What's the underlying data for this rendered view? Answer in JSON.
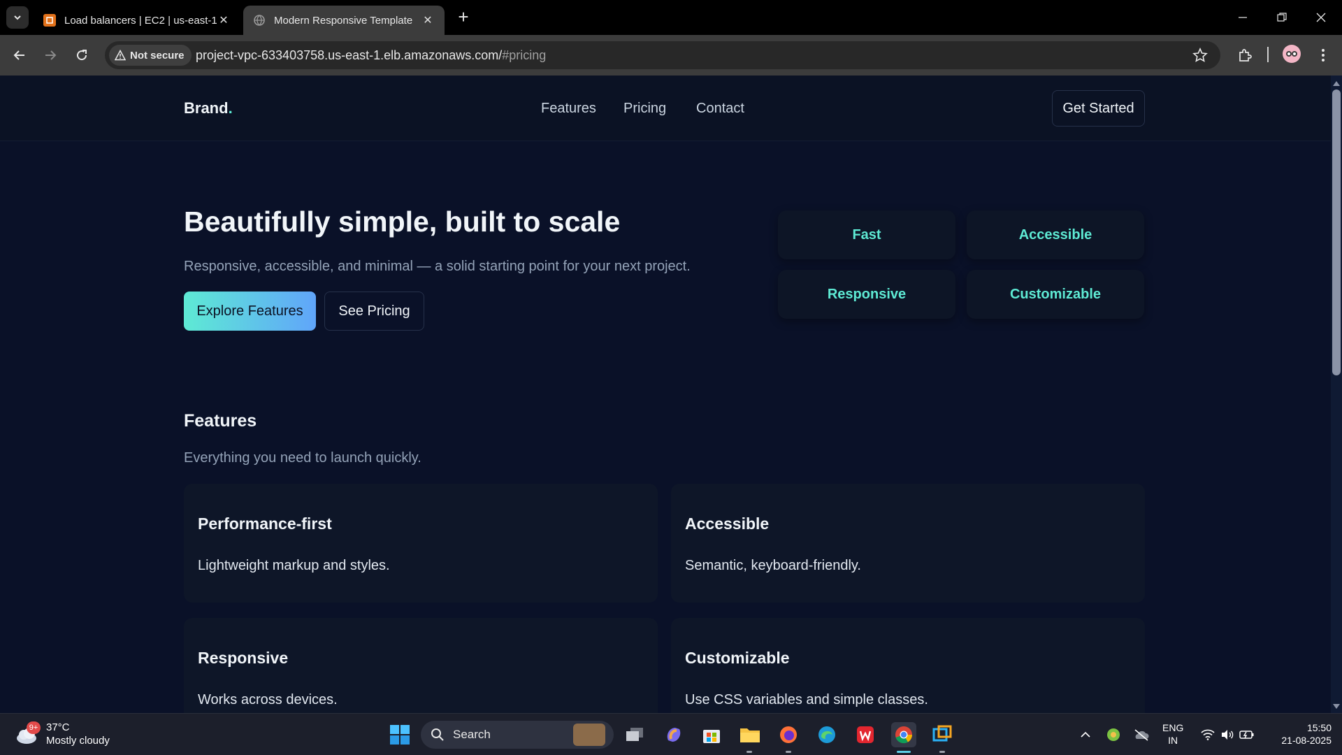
{
  "browser": {
    "tabs": [
      {
        "title": "Load balancers | EC2 | us-east-1",
        "active": false,
        "favicon": "aws-icon"
      },
      {
        "title": "Modern Responsive Template",
        "active": true,
        "favicon": "globe-icon"
      }
    ],
    "security_chip": "Not secure",
    "url_host": "project-vpc-633403758.us-east-1.elb.amazonaws.com/",
    "url_fragment": "#pricing"
  },
  "site": {
    "brand": "Brand",
    "brand_dot": ".",
    "nav": [
      "Features",
      "Pricing",
      "Contact"
    ],
    "cta": "Get Started",
    "hero": {
      "title": "Beautifully simple, built to scale",
      "subtitle": "Responsive, accessible, and minimal — a solid starting point for your next project.",
      "primary_button": "Explore Features",
      "secondary_button": "See Pricing",
      "pills": [
        "Fast",
        "Accessible",
        "Responsive",
        "Customizable"
      ]
    },
    "features": {
      "title": "Features",
      "subtitle": "Everything you need to launch quickly.",
      "cards": [
        {
          "title": "Performance-first",
          "text": "Lightweight markup and styles."
        },
        {
          "title": "Accessible",
          "text": "Semantic, keyboard-friendly."
        },
        {
          "title": "Responsive",
          "text": "Works across devices."
        },
        {
          "title": "Customizable",
          "text": "Use CSS variables and simple classes."
        }
      ]
    },
    "colors": {
      "background": "#0a1128",
      "accent": "#5eead4",
      "accent2": "#60a5fa"
    }
  },
  "taskbar": {
    "weather_badge": "9+",
    "temperature": "37°C",
    "condition": "Mostly cloudy",
    "search_label": "Search",
    "lang_top": "ENG",
    "lang_bottom": "IN",
    "time": "15:50",
    "date": "21-08-2025"
  }
}
